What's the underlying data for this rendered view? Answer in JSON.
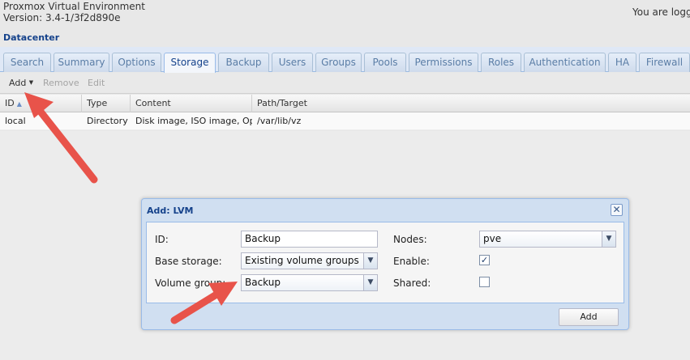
{
  "header": {
    "title": "Proxmox Virtual Environment",
    "version": "Version: 3.4-1/3f2d890e",
    "user_text": "You are logge"
  },
  "breadcrumb": "Datacenter",
  "tabs": [
    {
      "label": "Search"
    },
    {
      "label": "Summary"
    },
    {
      "label": "Options"
    },
    {
      "label": "Storage",
      "active": true
    },
    {
      "label": "Backup"
    },
    {
      "label": "Users"
    },
    {
      "label": "Groups"
    },
    {
      "label": "Pools"
    },
    {
      "label": "Permissions"
    },
    {
      "label": "Roles"
    },
    {
      "label": "Authentication"
    },
    {
      "label": "HA"
    },
    {
      "label": "Firewall"
    }
  ],
  "toolbar": {
    "add_label": "Add",
    "remove_label": "Remove",
    "edit_label": "Edit"
  },
  "grid": {
    "columns": [
      "ID",
      "Type",
      "Content",
      "Path/Target"
    ],
    "rows": [
      [
        "local",
        "Directory",
        "Disk image, ISO image, Op...",
        "/var/lib/vz"
      ]
    ]
  },
  "dialog": {
    "title": "Add: LVM",
    "close_icon": "close-icon",
    "fields": {
      "id_label": "ID:",
      "id_value": "Backup",
      "base_storage_label": "Base storage:",
      "base_storage_value": "Existing volume groups",
      "volume_group_label": "Volume group:",
      "volume_group_value": "Backup",
      "nodes_label": "Nodes:",
      "nodes_value": "pve",
      "enable_label": "Enable:",
      "enable_checked": true,
      "shared_label": "Shared:",
      "shared_checked": false
    },
    "add_button_label": "Add"
  },
  "colors": {
    "accent": "#15428b",
    "annotation_arrow": "#e8534a"
  }
}
